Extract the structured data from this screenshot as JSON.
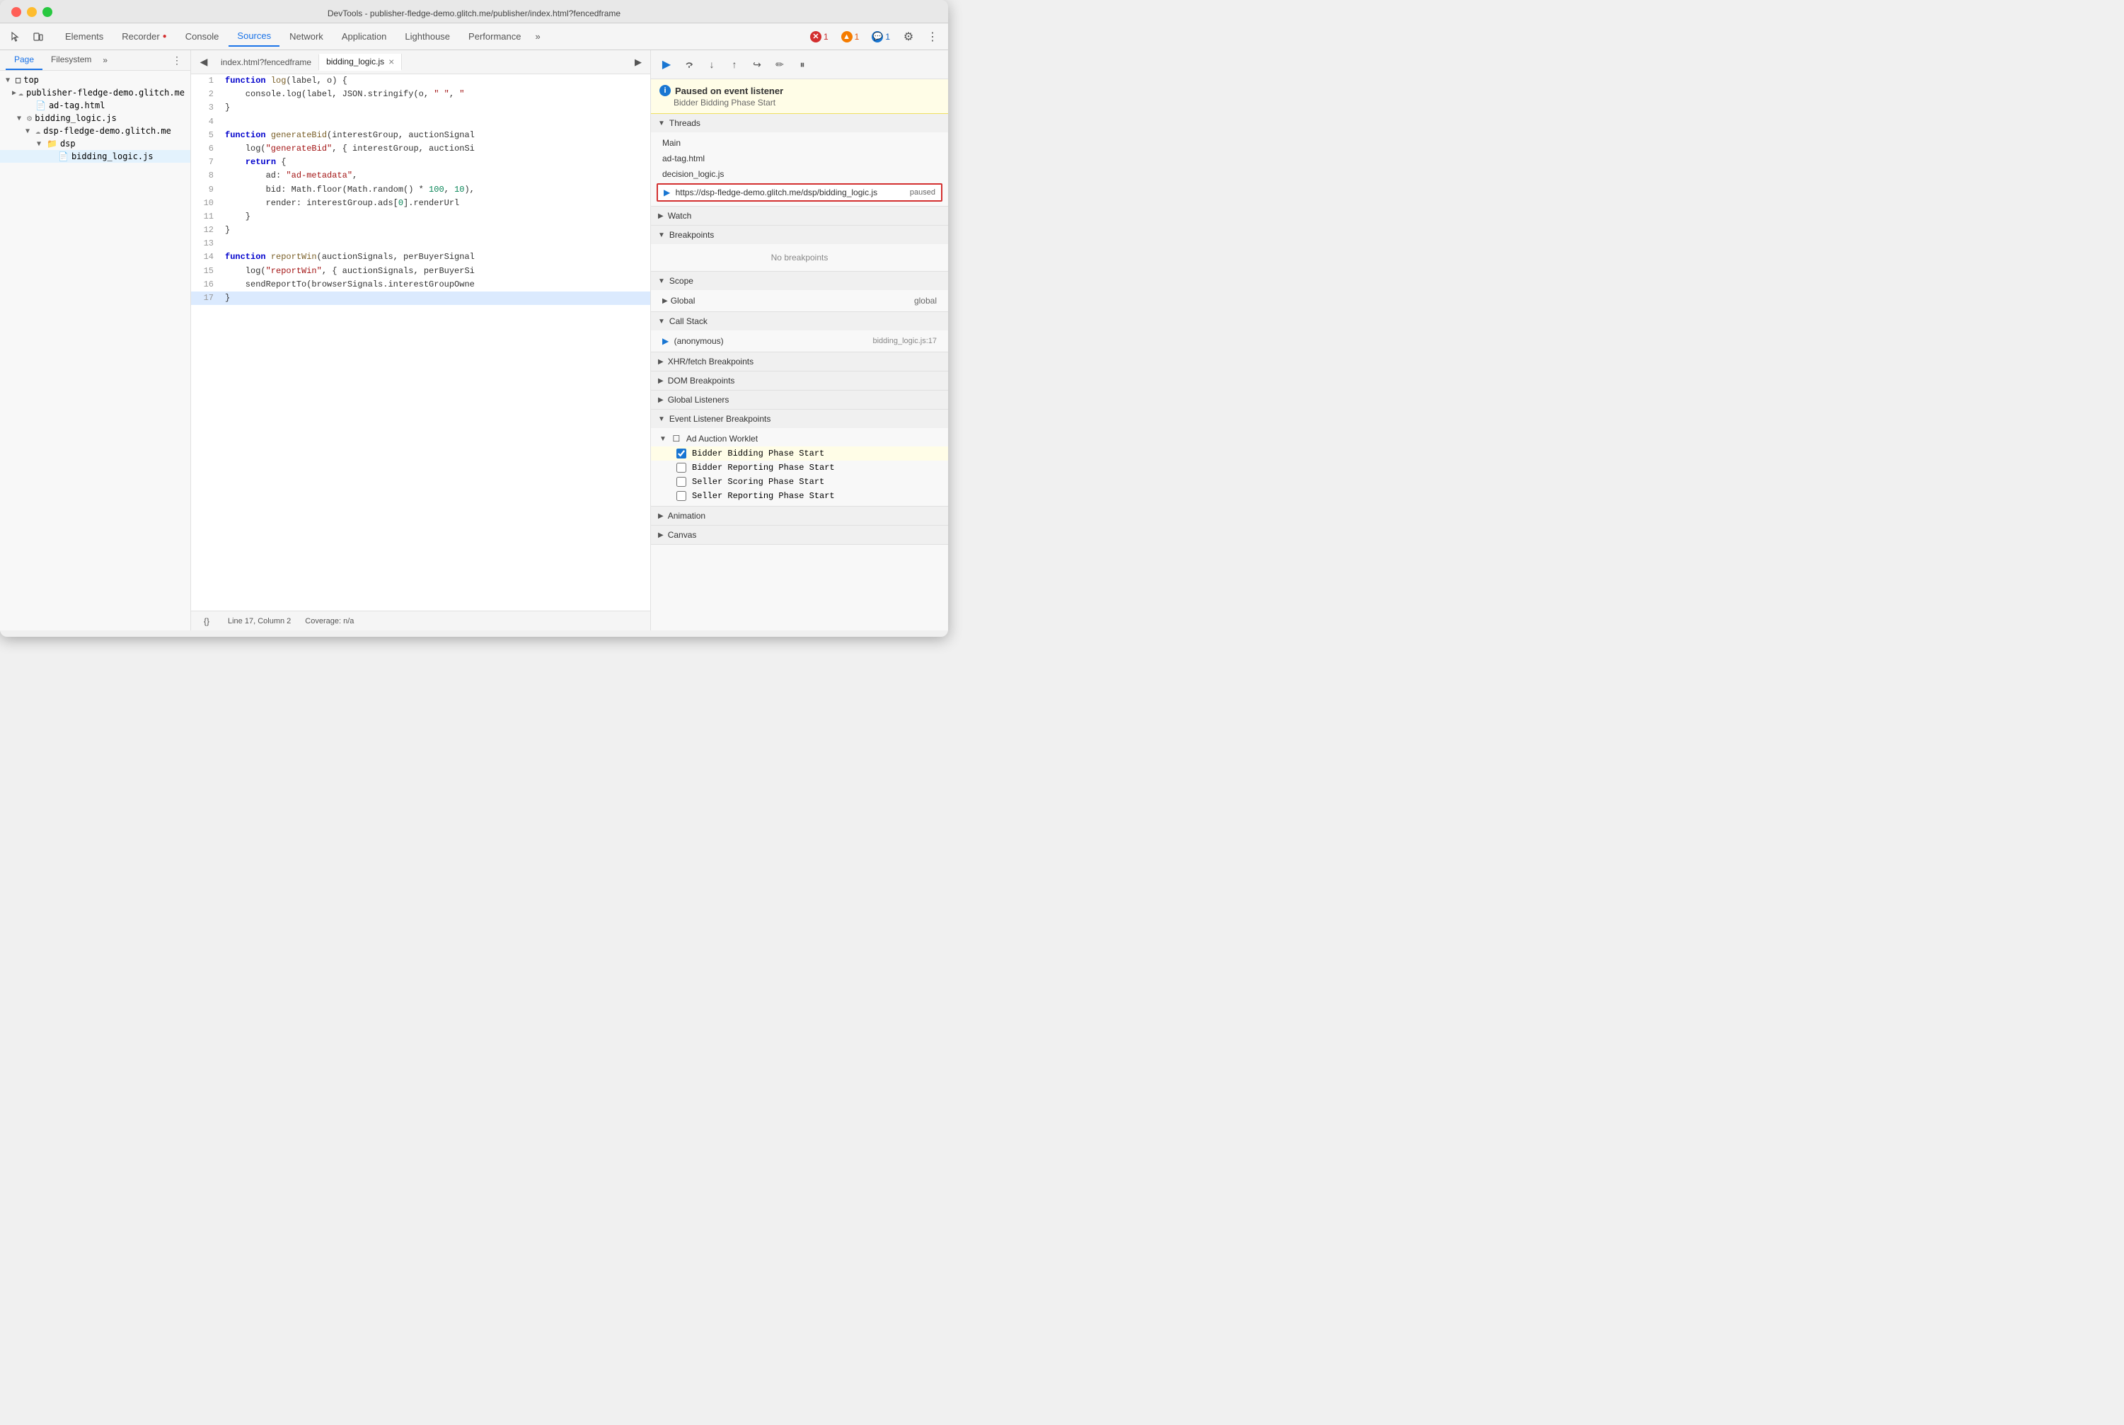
{
  "window": {
    "title": "DevTools - publisher-fledge-demo.glitch.me/publisher/index.html?fencedframe",
    "controls": {
      "close": "close",
      "minimize": "minimize",
      "maximize": "maximize"
    }
  },
  "toolbar": {
    "tabs": [
      {
        "id": "elements",
        "label": "Elements",
        "active": false
      },
      {
        "id": "recorder",
        "label": "Recorder",
        "active": false,
        "hasIcon": true
      },
      {
        "id": "console",
        "label": "Console",
        "active": false
      },
      {
        "id": "sources",
        "label": "Sources",
        "active": true
      },
      {
        "id": "network",
        "label": "Network",
        "active": false
      },
      {
        "id": "application",
        "label": "Application",
        "active": false
      },
      {
        "id": "lighthouse",
        "label": "Lighthouse",
        "active": false
      },
      {
        "id": "performance",
        "label": "Performance",
        "active": false
      }
    ],
    "overflow_label": "»",
    "badges": {
      "errors": "1",
      "warnings": "1",
      "info": "1"
    }
  },
  "left_panel": {
    "tabs": [
      {
        "id": "page",
        "label": "Page",
        "active": true
      },
      {
        "id": "filesystem",
        "label": "Filesystem",
        "active": false
      }
    ],
    "overflow": "»",
    "file_tree": [
      {
        "id": "top",
        "label": "top",
        "indent": 0,
        "type": "root",
        "expanded": true
      },
      {
        "id": "publisher",
        "label": "publisher-fledge-demo.glitch.me",
        "indent": 1,
        "type": "cloud",
        "expanded": false
      },
      {
        "id": "ad-tag",
        "label": "ad-tag.html",
        "indent": 1,
        "type": "file",
        "expanded": false
      },
      {
        "id": "bidding-logic-root",
        "label": "bidding_logic.js",
        "indent": 1,
        "type": "gear",
        "expanded": true
      },
      {
        "id": "dsp-fledge",
        "label": "dsp-fledge-demo.glitch.me",
        "indent": 2,
        "type": "cloud",
        "expanded": true
      },
      {
        "id": "dsp-folder",
        "label": "dsp",
        "indent": 3,
        "type": "folder",
        "expanded": true
      },
      {
        "id": "bidding-logic-file",
        "label": "bidding_logic.js",
        "indent": 4,
        "type": "js",
        "expanded": false,
        "selected": true
      }
    ]
  },
  "editor": {
    "tabs": [
      {
        "id": "index-html",
        "label": "index.html?fencedframe",
        "active": false,
        "closeable": false
      },
      {
        "id": "bidding-logic",
        "label": "bidding_logic.js",
        "active": true,
        "closeable": true
      }
    ],
    "code_lines": [
      {
        "num": 1,
        "code": "function log(label, o) {"
      },
      {
        "num": 2,
        "code": "    console.log(label, JSON.stringify(o, \" \", \""
      },
      {
        "num": 3,
        "code": "}"
      },
      {
        "num": 4,
        "code": ""
      },
      {
        "num": 5,
        "code": "function generateBid(interestGroup, auctionSignal"
      },
      {
        "num": 6,
        "code": "    log(\"generateBid\", { interestGroup, auctionSi"
      },
      {
        "num": 7,
        "code": "    return {"
      },
      {
        "num": 8,
        "code": "        ad: \"ad-metadata\","
      },
      {
        "num": 9,
        "code": "        bid: Math.floor(Math.random() * 100, 10),"
      },
      {
        "num": 10,
        "code": "        render: interestGroup.ads[0].renderUrl"
      },
      {
        "num": 11,
        "code": "    }"
      },
      {
        "num": 12,
        "code": "}"
      },
      {
        "num": 13,
        "code": ""
      },
      {
        "num": 14,
        "code": "function reportWin(auctionSignals, perBuyerSignal"
      },
      {
        "num": 15,
        "code": "    log(\"reportWin\", { auctionSignals, perBuyerSi"
      },
      {
        "num": 16,
        "code": "    sendReportTo(browserSignals.interestGroupOwne"
      },
      {
        "num": 17,
        "code": "}",
        "highlight": true
      }
    ],
    "status": {
      "line": "Line 17, Column 2",
      "coverage": "Coverage: n/a",
      "format_icon": "{}"
    }
  },
  "right_panel": {
    "debug_toolbar": {
      "buttons": [
        {
          "id": "resume",
          "icon": "▶",
          "label": "Resume",
          "active": true,
          "blue": true
        },
        {
          "id": "step-over",
          "icon": "↷",
          "label": "Step over"
        },
        {
          "id": "step-into",
          "icon": "↓",
          "label": "Step into"
        },
        {
          "id": "step-out",
          "icon": "↑",
          "label": "Step out"
        },
        {
          "id": "step",
          "icon": "↪",
          "label": "Step"
        },
        {
          "id": "deactivate",
          "icon": "✏",
          "label": "Deactivate breakpoints"
        },
        {
          "id": "pause-exceptions",
          "icon": "⏸",
          "label": "Pause on exceptions"
        }
      ]
    },
    "paused_banner": {
      "title": "Paused on event listener",
      "subtitle": "Bidder Bidding Phase Start"
    },
    "sections": [
      {
        "id": "threads",
        "label": "Threads",
        "expanded": true,
        "items": [
          {
            "id": "main",
            "label": "Main",
            "type": "thread"
          },
          {
            "id": "ad-tag",
            "label": "ad-tag.html",
            "type": "thread"
          },
          {
            "id": "decision-logic",
            "label": "decision_logic.js",
            "type": "thread"
          },
          {
            "id": "bidding-logic-thread",
            "label": "https://dsp-fledge-demo.glitch.me/dsp/bidding_logic.js",
            "status": "paused",
            "type": "thread-selected"
          }
        ]
      },
      {
        "id": "watch",
        "label": "Watch",
        "expanded": false
      },
      {
        "id": "breakpoints",
        "label": "Breakpoints",
        "expanded": true,
        "empty_label": "No breakpoints"
      },
      {
        "id": "scope",
        "label": "Scope",
        "expanded": true,
        "items": [
          {
            "id": "global",
            "label": "Global",
            "value": "global"
          }
        ]
      },
      {
        "id": "call-stack",
        "label": "Call Stack",
        "expanded": true,
        "items": [
          {
            "id": "anonymous",
            "label": "(anonymous)",
            "location": "bidding_logic.js:17"
          }
        ]
      },
      {
        "id": "xhr-fetch",
        "label": "XHR/fetch Breakpoints",
        "expanded": false
      },
      {
        "id": "dom-breakpoints",
        "label": "DOM Breakpoints",
        "expanded": false
      },
      {
        "id": "global-listeners",
        "label": "Global Listeners",
        "expanded": false
      },
      {
        "id": "event-listener-breakpoints",
        "label": "Event Listener Breakpoints",
        "expanded": true,
        "sub_sections": [
          {
            "id": "ad-auction-worklet",
            "label": "Ad Auction Worklet",
            "expanded": true,
            "items": [
              {
                "id": "bidder-bidding-start",
                "label": "Bidder Bidding Phase Start",
                "checked": true,
                "highlighted": true
              },
              {
                "id": "bidder-reporting-start",
                "label": "Bidder Reporting Phase Start",
                "checked": false
              },
              {
                "id": "seller-scoring-start",
                "label": "Seller Scoring Phase Start",
                "checked": false
              },
              {
                "id": "seller-reporting-start",
                "label": "Seller Reporting Phase Start",
                "checked": false
              }
            ]
          }
        ]
      },
      {
        "id": "animation",
        "label": "Animation",
        "expanded": false
      },
      {
        "id": "canvas",
        "label": "Canvas",
        "expanded": false
      }
    ]
  }
}
